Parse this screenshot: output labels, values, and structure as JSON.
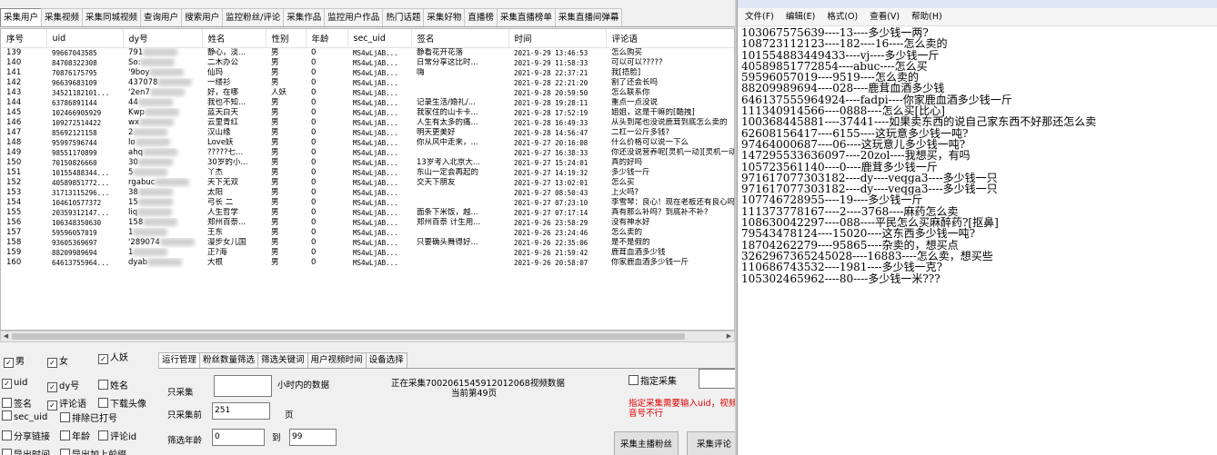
{
  "app": {
    "tabs": [
      "采集用户",
      "采集视频",
      "采集同城视频",
      "查询用户",
      "搜索用户",
      "监控粉丝/评论",
      "采集作品",
      "监控用户作品",
      "热门话题",
      "采集好物",
      "直播榜",
      "采集直播榜单",
      "采集直播间弹幕"
    ],
    "active_tab": 0,
    "columns": [
      "序号",
      "uid",
      "dy号",
      "姓名",
      "性别",
      "年龄",
      "sec_uid",
      "签名",
      "时间",
      "评论语"
    ],
    "rows": [
      [
        "139",
        "99667043585",
        "791",
        "静心，淡...",
        "男",
        "0",
        "MS4wLjAB...",
        "静看花开花落",
        "2021-9-29 13:46:53",
        "怎么购买"
      ],
      [
        "140",
        "84708322308",
        "So:",
        "二木办公",
        "男",
        "0",
        "MS4wLjAB...",
        "日常分享这比时...",
        "2021-9-29 11:58:33",
        "可以可以?????"
      ],
      [
        "141",
        "70876175795",
        "'9boy",
        "仙玛",
        "男",
        "0",
        "MS4wLjAB...",
        "嗨",
        "2021-9-28 22:37:21",
        "我[捂脸]"
      ],
      [
        "142",
        "96639683109",
        "437078",
        "一缕衫",
        "男",
        "0",
        "MS4wLjAB...",
        "",
        "2021-9-28 22:21:20",
        "割了还会长吗"
      ],
      [
        "143",
        "34521182101...",
        "'2en7",
        "好，在哪",
        "人妖",
        "0",
        "MS4wLjAB...",
        "",
        "2021-9-28 20:59:50",
        "怎么联系你"
      ],
      [
        "144",
        "63786891144",
        "44",
        "我也不知...",
        "男",
        "0",
        "MS4wLjAB...",
        "记录生活/婚礼/...",
        "2021-9-28 19:28:11",
        "重点一点没说"
      ],
      [
        "145",
        "102466905929",
        "Kwp",
        "蓝天白天",
        "男",
        "0",
        "MS4wLjAB...",
        "我家住的山卡卡...",
        "2021-9-28 17:52:19",
        "姐姐，这是干嘛的[酷拽]"
      ],
      [
        "146",
        "109272514422",
        "wx",
        "云里青红",
        "男",
        "0",
        "MS4wLjAB...",
        "人生有太多的痛...",
        "2021-9-28 16:49:33",
        "从头到尾也没说鹿茸到底怎么卖的"
      ],
      [
        "147",
        "85692121158",
        "2",
        "汉山缘",
        "男",
        "0",
        "MS4wLjAB...",
        "明天更美好",
        "2021-9-28 14:56:47",
        "二杠一公斤多钱?"
      ],
      [
        "148",
        "95997596744",
        "lo",
        "Love妖",
        "男",
        "0",
        "MS4wLjAB...",
        "你从风中走来，...",
        "2021-9-27 20:16:08",
        "什么价格可以说一下么"
      ],
      [
        "149",
        "98551170899",
        "ahq",
        "?????七...",
        "男",
        "0",
        "MS4wLjAB...",
        "",
        "2021-9-27 16:38:33",
        "你还没说营养呢[灵机一动][灵机一动]"
      ],
      [
        "150",
        "70150826660",
        "30",
        "30岁的小...",
        "男",
        "0",
        "MS4wLjAB...",
        "13岁考入北京大...",
        "2021-9-27 15:24:01",
        "真的好吗"
      ],
      [
        "151",
        "10155488344...",
        "5",
        "丫杰",
        "男",
        "0",
        "MS4wLjAB...",
        "东山一定会再起的",
        "2021-9-27 14:19:32",
        "多少钱一斤"
      ],
      [
        "152",
        "40589851772...",
        "rgabuc",
        "天下无双",
        "男",
        "0",
        "MS4wLjAB...",
        "交天下朋友",
        "2021-9-27 13:02:01",
        "怎么买"
      ],
      [
        "153",
        "31713115296...",
        "38",
        "太阳",
        "男",
        "0",
        "MS4wLjAB...",
        "",
        "2021-9-27 08:50:43",
        "上火吗?"
      ],
      [
        "154",
        "104610577372",
        "15",
        "弓长 二",
        "男",
        "0",
        "MS4wLjAB...",
        "",
        "2021-9-27 07:23:10",
        "李雪琴：良心！现在老板还有良心吗"
      ],
      [
        "155",
        "20359312147...",
        "liq",
        "人生哲学",
        "男",
        "0",
        "MS4wLjAB...",
        "面条下米饭，越...",
        "2021-9-27 07:17:14",
        "真有那么补吗？到底补不补?"
      ],
      [
        "156",
        "106348350630",
        "158",
        "郑州百萘...",
        "男",
        "0",
        "MS4wLjAB...",
        "郑州百萘 计生用...",
        "2021-9-26 23:58:29",
        "没有神水好"
      ],
      [
        "157",
        "59596057019",
        "1",
        "王东",
        "男",
        "0",
        "MS4wLjAB...",
        "",
        "2021-9-26 23:24:46",
        "怎么卖的"
      ],
      [
        "158",
        "93605369697",
        "'289074",
        "漫步女儿国",
        "男",
        "0",
        "MS4wLjAB...",
        "只要确头舞得好...",
        "2021-9-26 22:35:06",
        "是不是假的"
      ],
      [
        "159",
        "88209989694",
        "1",
        "正?海",
        "男",
        "0",
        "MS4wLjAB...",
        "",
        "2021-9-26 21:59:42",
        "鹿茸血酒多少钱"
      ],
      [
        "160",
        "64613755964...",
        "dyab",
        "大根",
        "男",
        "0",
        "MS4wLjAB...",
        "",
        "2021-9-26 20:58:07",
        "你家鹿血酒多少钱一斤"
      ]
    ],
    "gender_filters": [
      {
        "label": "男",
        "checked": true
      },
      {
        "label": "女",
        "checked": true
      },
      {
        "label": "人妖",
        "checked": true
      }
    ],
    "field_checks": [
      {
        "label": "uid",
        "checked": true
      },
      {
        "label": "dy号",
        "checked": true
      },
      {
        "label": "姓名",
        "checked": false
      },
      {
        "label": "签名",
        "checked": false
      },
      {
        "label": "评论语",
        "checked": true
      },
      {
        "label": "下载头像",
        "checked": false
      },
      {
        "label": "sec_uid",
        "checked": false
      },
      {
        "label": "排除已打号",
        "checked": false
      },
      {
        "label": "分享链接",
        "checked": false
      },
      {
        "label": "年龄",
        "checked": false
      },
      {
        "label": "评论id",
        "checked": false
      },
      {
        "label": "导出时间",
        "checked": false
      },
      {
        "label": "导出加上前缀",
        "checked": false
      }
    ],
    "bottom_tabs": [
      "运行管理",
      "粉丝数量筛选",
      "筛选关键词",
      "用户视频时间",
      "设备选择"
    ],
    "run": {
      "only_collect_label": "只采集",
      "only_collect_value": "",
      "hours_suffix": "小时内的数据",
      "pages_label": "只采集前",
      "pages_value": "251",
      "pages_suffix": "页",
      "age_label": "筛选年龄",
      "age_min": "0",
      "age_to": "到",
      "age_max": "99",
      "status_line1": "正在采集7002061545912012068视频数据",
      "status_line2": "当前第49页"
    },
    "right_panel": {
      "specify_label": "指定采集",
      "specify_value": "",
      "warning": "指定采集需要输入uid，视频",
      "warning2": "音号不行",
      "btn_host_fans": "采集主播粉丝",
      "btn_collect_comment": "采集评论"
    }
  },
  "notepad": {
    "menu": [
      "文件(F)",
      "编辑(E)",
      "格式(O)",
      "查看(V)",
      "帮助(H)"
    ],
    "lines": [
      "103067575639----13----多少钱一两?",
      "108723112123----182----16----怎么卖的",
      "101554883449433----vj----多少钱一斤",
      "40589851772854----abuc----怎么买",
      "59596057019----9519----怎么卖的",
      "88209989694----028----鹿茸血酒多少钱",
      "646137555964924----fadpi----你家鹿血酒多少钱一斤",
      "111340914566----0888----怎么买[比心]",
      "100368445881----37441----如果卖东西的说自己家东西不好那还怎么卖",
      "62608156417----6155----这玩意多少钱一吨?",
      "97464000687----06----这玩意儿多少钱一吨?",
      "147295533636097----20zol----我想买，有吗",
      "105723561140----0----鹿茸多少钱一斤",
      "971617077303182----dy----veqga3----多少钱一只",
      "971617077303182----dy----veqga3----多少钱一只",
      "107746728955----19----多少钱一斤",
      "111373778167----2----3768----麻药怎么卖",
      "108630042297----088----平民怎么买麻醉药?[抠鼻]",
      "79543478124----15020----这东西多少钱一吨?",
      "18704262279----95865----杂卖的，想买点",
      "3262967365245028----16883----怎么卖，想买些",
      "110686743532----1981----多少钱一克?",
      "105302465962----80----多少钱一米???"
    ]
  }
}
